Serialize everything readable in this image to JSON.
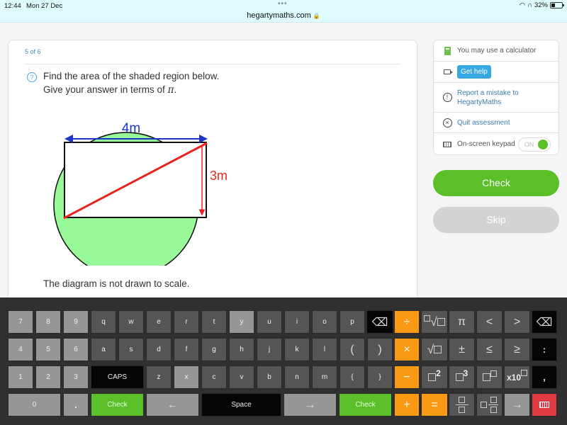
{
  "status_bar": {
    "time": "12:44",
    "date": "Mon 27 Dec",
    "battery": "32%",
    "url": "hegartymaths.com"
  },
  "question": {
    "progress": "5 of 6",
    "line1": "Find the area of the shaded region below.",
    "line2_prefix": "Give your answer in terms of ",
    "line2_symbol": "π",
    "line2_suffix": ".",
    "note": "The diagram is not drawn to scale.",
    "diagram": {
      "width_label": "4m",
      "height_label": "3m",
      "shade_color": "#98f998",
      "width_color": "#1a35c8",
      "height_color": "#e8231e"
    }
  },
  "side_panel": {
    "calculator": "You may use a calculator",
    "get_help": "Get help",
    "report_line1": "Report a mistake to",
    "report_line2": "HegartyMaths",
    "quit": "Quit assessment",
    "keypad_label": "On-screen keypad",
    "keypad_toggle": "ON"
  },
  "actions": {
    "check": "Check",
    "skip": "Skip"
  },
  "keypad": {
    "row1": [
      "7",
      "8",
      "9",
      "q",
      "w",
      "e",
      "r",
      "t",
      "y",
      "u",
      "i",
      "o",
      "p"
    ],
    "row2": [
      "4",
      "5",
      "6",
      "a",
      "s",
      "d",
      "f",
      "g",
      "h",
      "j",
      "k",
      "l",
      "(",
      ")"
    ],
    "row3": [
      "1",
      "2",
      "3",
      "CAPS",
      "z",
      "x",
      "c",
      "v",
      "b",
      "n",
      "m",
      "{",
      "}"
    ],
    "zero": "0",
    "dot": ".",
    "check": "Check",
    "left_arrow": "←",
    "space": "Space",
    "right_arrow": "→",
    "check2": "Check",
    "divide": "÷",
    "multiply": "×",
    "minus": "−",
    "plus": "+",
    "equals": "=",
    "pi": "π",
    "lt": "<",
    "gt": ">",
    "pm": "±",
    "le": "≤",
    "ge": "≥",
    "colon": ":",
    "comma": ",",
    "sq": "2",
    "cube": "3",
    "x10": "x10",
    "nav_right": "→"
  }
}
